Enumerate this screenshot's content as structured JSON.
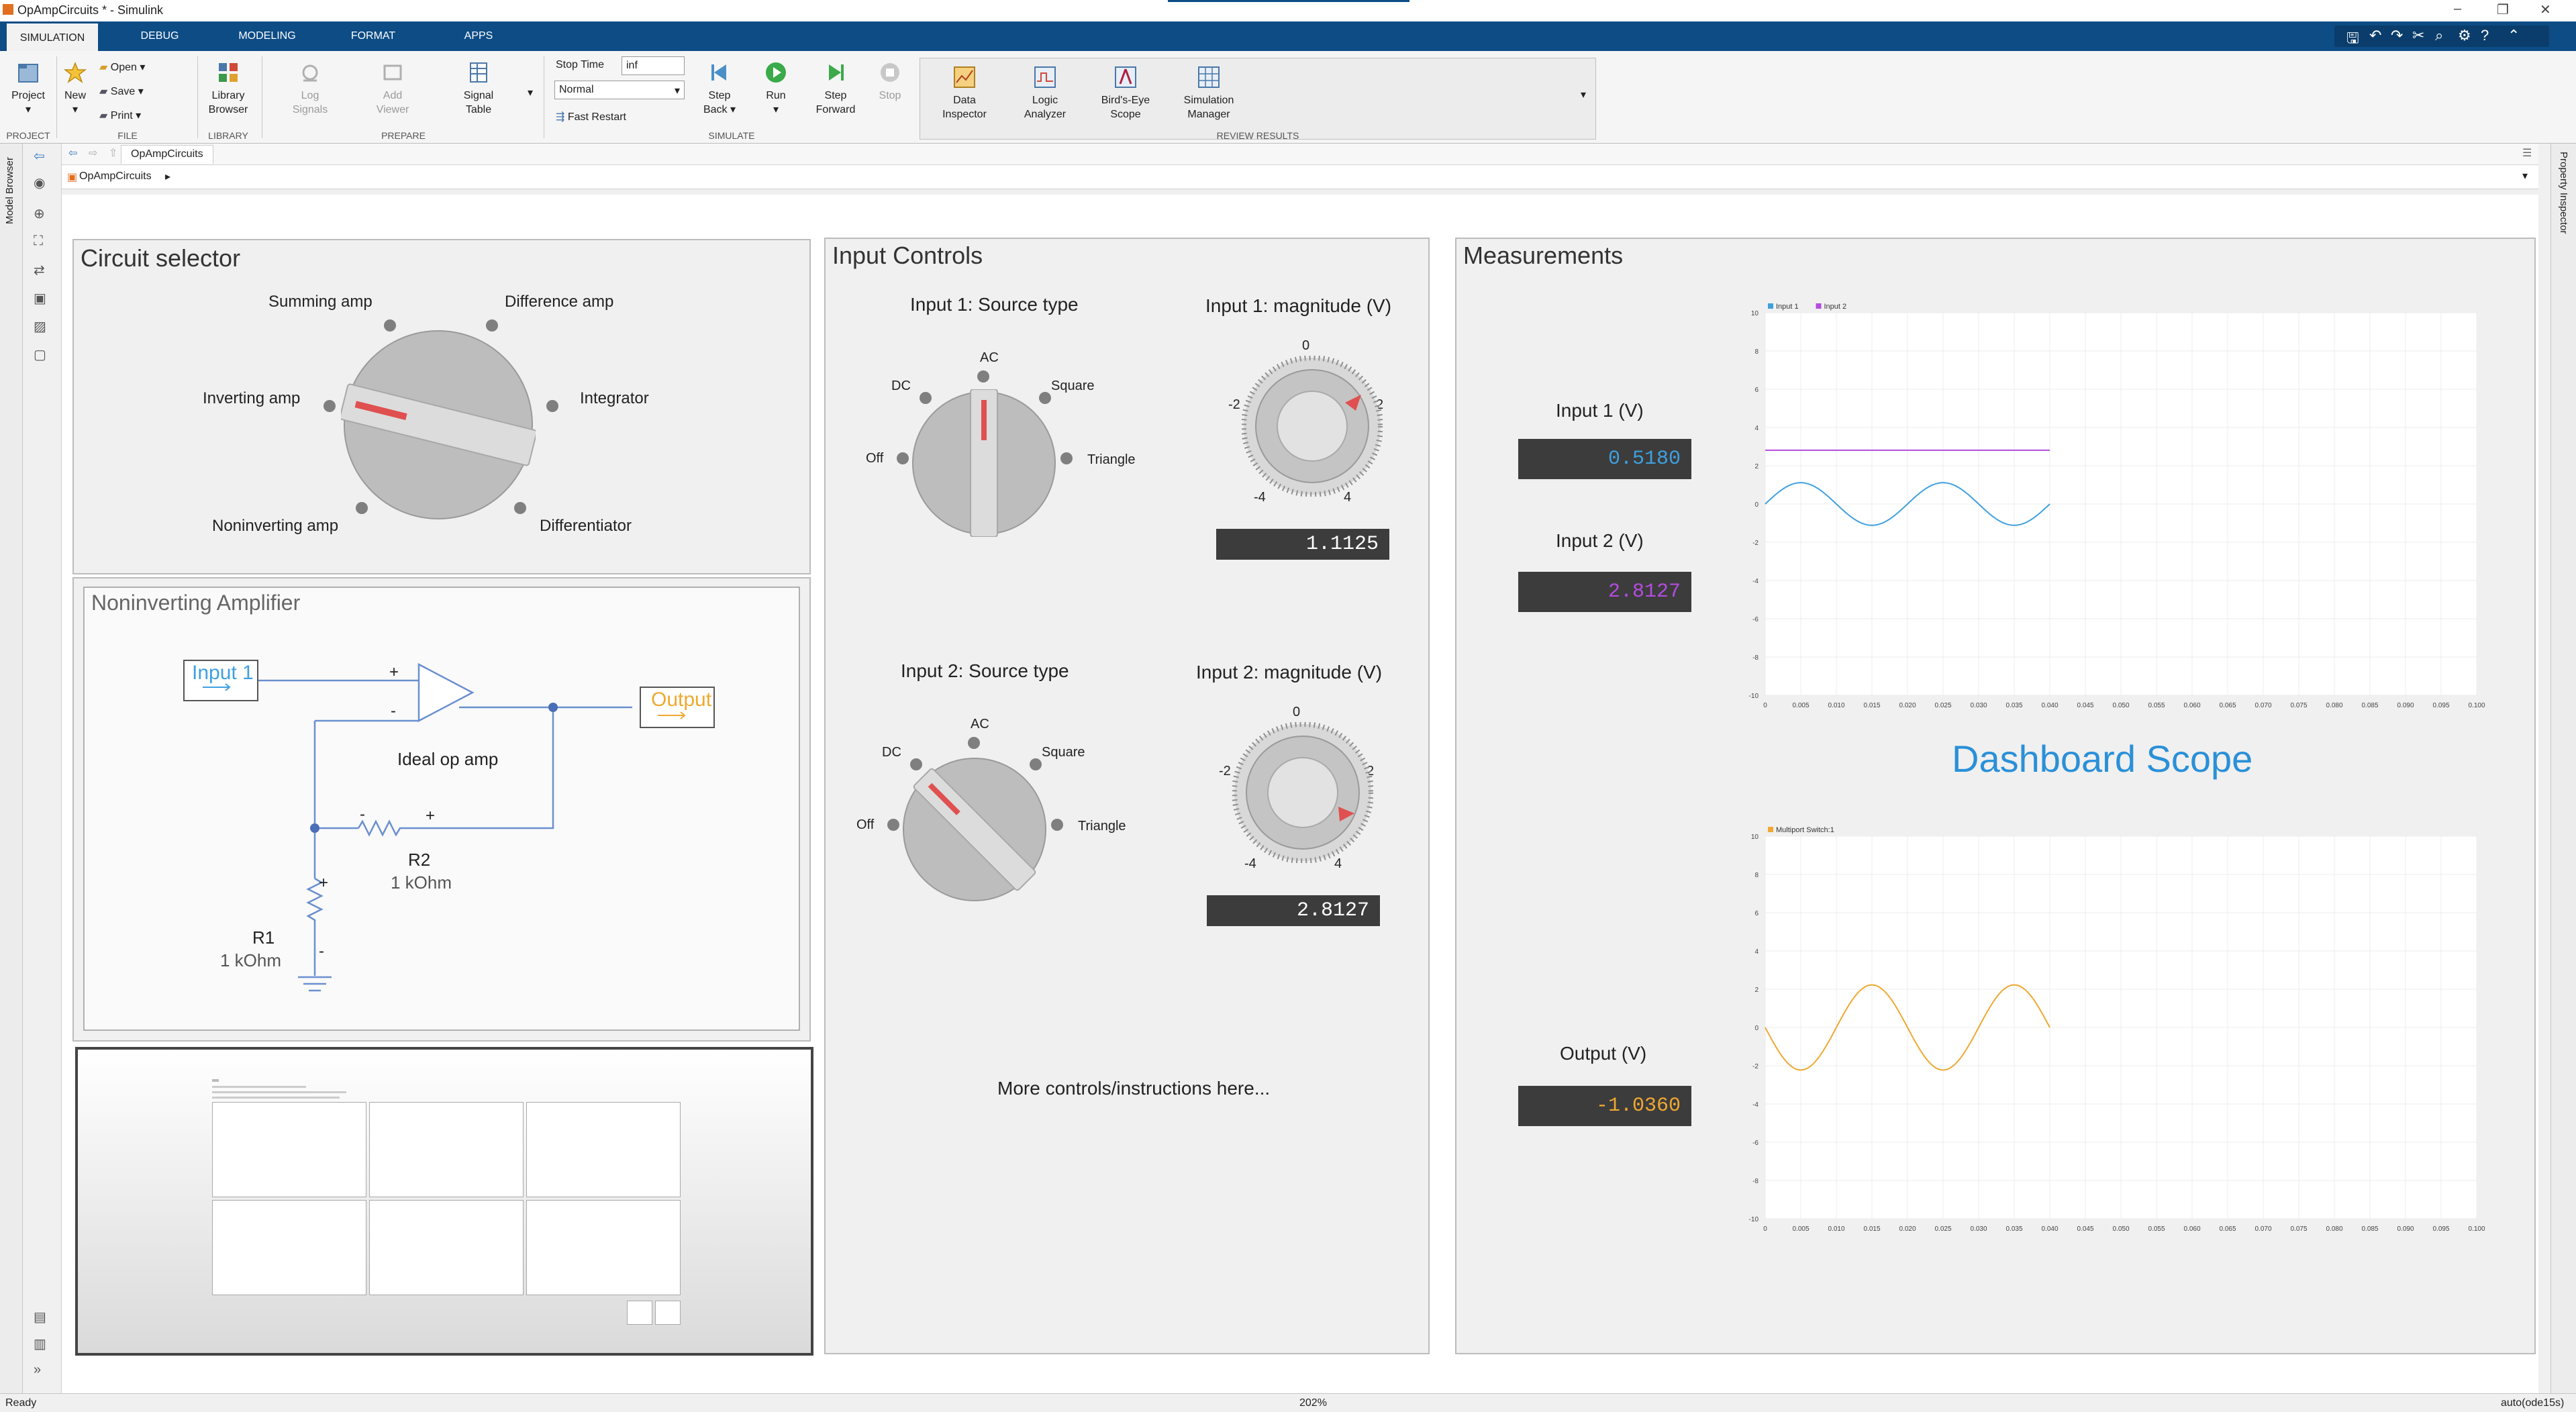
{
  "window": {
    "title": "OpAmpCircuits * - Simulink"
  },
  "tabs": [
    "SIMULATION",
    "DEBUG",
    "MODELING",
    "FORMAT",
    "APPS"
  ],
  "toolstrip": {
    "project": {
      "label": "Project",
      "section": "PROJECT"
    },
    "new": "New",
    "open": "Open",
    "save": "Save",
    "print": "Print",
    "file_section": "FILE",
    "library_browser": [
      "Library",
      "Browser"
    ],
    "library_section": "LIBRARY",
    "log_signals": [
      "Log",
      "Signals"
    ],
    "add_viewer": [
      "Add",
      "Viewer"
    ],
    "signal_table": [
      "Signal",
      "Table"
    ],
    "prepare_section": "PREPARE",
    "stop_time_label": "Stop Time",
    "stop_time_value": "inf",
    "sim_mode": "Normal",
    "fast_restart": "Fast Restart",
    "step_back": [
      "Step",
      "Back"
    ],
    "run": "Run",
    "step_forward": [
      "Step",
      "Forward"
    ],
    "stop": "Stop",
    "simulate_section": "SIMULATE",
    "data_inspector": [
      "Data",
      "Inspector"
    ],
    "logic_analyzer": [
      "Logic",
      "Analyzer"
    ],
    "birds_eye": [
      "Bird's-Eye",
      "Scope"
    ],
    "sim_manager": [
      "Simulation",
      "Manager"
    ],
    "review_section": "REVIEW RESULTS"
  },
  "side": {
    "model_browser": "Model Browser",
    "property_inspector": "Property Inspector"
  },
  "nav": {
    "tab": "OpAmpCircuits",
    "breadcrumb": "OpAmpCircuits"
  },
  "circuit_selector": {
    "title": "Circuit selector",
    "options": [
      "Summing amp",
      "Difference amp",
      "Inverting amp",
      "Integrator",
      "Noninverting amp",
      "Differentiator"
    ]
  },
  "schematic": {
    "title": "Noninverting Amplifier",
    "input_label": "Input 1",
    "output_label": "Output",
    "opamp_label": "Ideal op amp",
    "plus": "+",
    "minus": "-",
    "r1_name": "R1",
    "r1_value": "1 kOhm",
    "r2_name": "R2",
    "r2_value": "1 kOhm"
  },
  "input_controls": {
    "title": "Input Controls",
    "src1_title": "Input 1: Source type",
    "src2_title": "Input 2: Source type",
    "src_options": {
      "off": "Off",
      "dc": "DC",
      "ac": "AC",
      "square": "Square",
      "triangle": "Triangle"
    },
    "src1_selected": "AC",
    "src2_selected": "DC",
    "mag1_title": "Input 1: magnitude (V)",
    "mag1_value": "1.1125",
    "mag2_title": "Input 2: magnitude (V)",
    "mag2_value": "2.8127",
    "knob_ticks": {
      "top": "0",
      "left": "-2",
      "right": "2",
      "bottom_left": "-4",
      "bottom_right": "4"
    },
    "more": "More controls/instructions here..."
  },
  "measurements": {
    "title": "Measurements",
    "in1_label": "Input 1 (V)",
    "in1_value": "0.5180",
    "in2_label": "Input 2 (V)",
    "in2_value": "2.8127",
    "out_label": "Output (V)",
    "out_value": "-1.0360",
    "dashboard_scope": "Dashboard Scope",
    "colors": {
      "in1": "#3fa0e0",
      "in2": "#b44ce0",
      "out": "#f0a830"
    }
  },
  "chart_data": [
    {
      "type": "line",
      "legend": [
        "Input 1",
        "Input 2"
      ],
      "xlim": [
        0,
        0.1
      ],
      "ylim": [
        -10,
        10
      ],
      "xticks": [
        "0",
        "0.005",
        "0.010",
        "0.015",
        "0.020",
        "0.025",
        "0.030",
        "0.035",
        "0.040",
        "0.045",
        "0.050",
        "0.055",
        "0.060",
        "0.065",
        "0.070",
        "0.075",
        "0.080",
        "0.085",
        "0.090",
        "0.095",
        "0.100"
      ],
      "yticks": [
        "10",
        "8",
        "6",
        "4",
        "2",
        "0",
        "-2",
        "-4",
        "-6",
        "-8",
        "-10"
      ],
      "series": [
        {
          "name": "Input 1",
          "color": "#3fa0e0",
          "wave": "sine",
          "amplitude": 1.1125,
          "frequency_hz": 50,
          "x_end": 0.04
        },
        {
          "name": "Input 2",
          "color": "#b44ce0",
          "wave": "constant",
          "value": 2.8127,
          "x_end": 0.04
        }
      ],
      "grid": true,
      "legend_position": "top-left"
    },
    {
      "type": "line",
      "legend": [
        "Multiport Switch:1"
      ],
      "xlim": [
        0,
        0.1
      ],
      "ylim": [
        -10,
        10
      ],
      "xticks": [
        "0",
        "0.005",
        "0.010",
        "0.015",
        "0.020",
        "0.025",
        "0.030",
        "0.035",
        "0.040",
        "0.045",
        "0.050",
        "0.055",
        "0.060",
        "0.065",
        "0.070",
        "0.075",
        "0.080",
        "0.085",
        "0.090",
        "0.095",
        "0.100"
      ],
      "yticks": [
        "10",
        "8",
        "6",
        "4",
        "2",
        "0",
        "-2",
        "-4",
        "-6",
        "-8",
        "-10"
      ],
      "series": [
        {
          "name": "Multiport Switch:1",
          "color": "#f0a830",
          "wave": "sine",
          "amplitude": 2.225,
          "frequency_hz": 50,
          "phase": 3.1416,
          "x_end": 0.04
        }
      ],
      "grid": true,
      "legend_position": "top-left"
    }
  ],
  "status": {
    "left": "Ready",
    "zoom": "202%",
    "solver": "auto(ode15s)"
  }
}
